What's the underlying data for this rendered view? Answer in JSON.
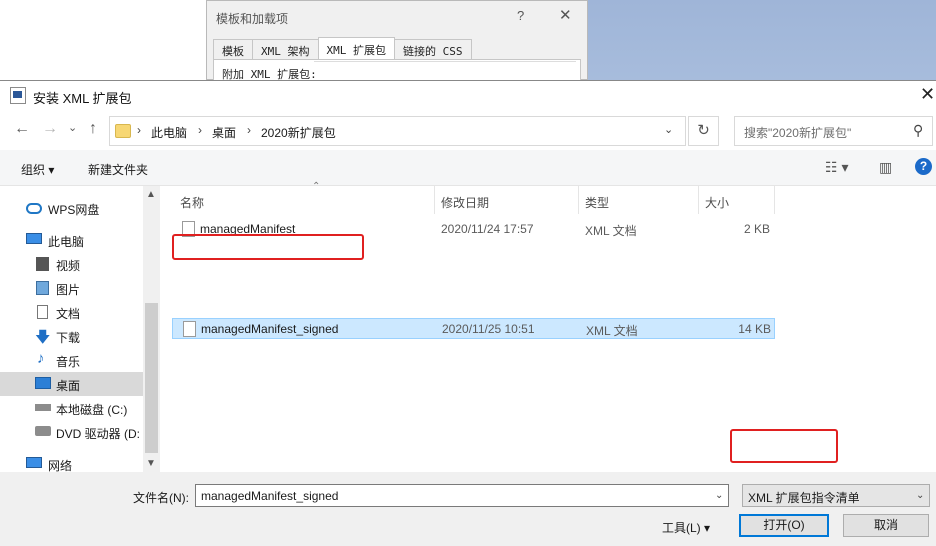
{
  "background_dialog": {
    "title": "模板和加载项",
    "help": "?",
    "close": "✕",
    "tabs": [
      "模板",
      "XML 架构",
      "XML 扩展包",
      "链接的 CSS"
    ],
    "panel_label": "附加 XML 扩展包:"
  },
  "dialog": {
    "title": "安装 XML 扩展包",
    "close": "✕"
  },
  "nav": {
    "back": "←",
    "forward": "→",
    "recent": "⌄",
    "up": "↑",
    "breadcrumb": [
      "此电脑",
      "桌面",
      "2020新扩展包"
    ],
    "separator": "›",
    "dropdown": "⌄",
    "refresh": "↻",
    "search_placeholder": "搜索\"2020新扩展包\""
  },
  "toolbar": {
    "organize": "组织 ▾",
    "new_folder": "新建文件夹",
    "view_options": "☷ ▾",
    "preview_pane": "▥",
    "help": "?"
  },
  "sidebar": {
    "items": [
      {
        "label": "WPS网盘",
        "icon": "cloud-icon"
      },
      {
        "label": "此电脑",
        "icon": "computer-icon"
      },
      {
        "label": "视频",
        "icon": "video-icon"
      },
      {
        "label": "图片",
        "icon": "picture-icon"
      },
      {
        "label": "文档",
        "icon": "document-icon"
      },
      {
        "label": "下载",
        "icon": "download-icon"
      },
      {
        "label": "音乐",
        "icon": "music-icon"
      },
      {
        "label": "桌面",
        "icon": "desktop-icon"
      },
      {
        "label": "本地磁盘 (C:)",
        "icon": "drive-icon"
      },
      {
        "label": "DVD 驱动器 (D:",
        "icon": "dvd-icon"
      },
      {
        "label": "网络",
        "icon": "network-icon"
      }
    ],
    "selected": "桌面"
  },
  "columns": [
    "名称",
    "修改日期",
    "类型",
    "大小"
  ],
  "files": [
    {
      "name": "managedManifest",
      "date": "2020/11/24 17:57",
      "type": "XML 文档",
      "size": "2 KB"
    },
    {
      "name": "managedManifest_signed",
      "date": "2020/11/25 10:51",
      "type": "XML 文档",
      "size": "14 KB"
    }
  ],
  "footer": {
    "filename_label": "文件名(N):",
    "filename_value": "managedManifest_signed",
    "filetype_value": "XML 扩展包指令清单",
    "tools": "工具(L) ▾",
    "open": "打开(O)",
    "cancel": "取消"
  },
  "colors": {
    "selection": "#cce8ff",
    "highlight": "#e02020",
    "accent": "#0078d7"
  }
}
